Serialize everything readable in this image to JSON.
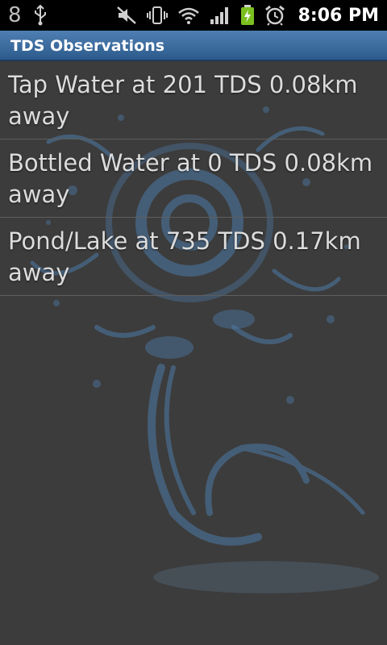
{
  "status_bar": {
    "notification_count": "8",
    "time": "8:06 PM",
    "icons": [
      "usb-icon",
      "mute-icon",
      "vibrate-icon",
      "wifi-icon",
      "signal-icon",
      "battery-charging-icon",
      "alarm-clock-icon"
    ]
  },
  "title_bar": {
    "title": "TDS Observations"
  },
  "observations": [
    {
      "label": "Tap Water at 201 TDS 0.08km away"
    },
    {
      "label": "Bottled Water at 0 TDS 0.08km away"
    },
    {
      "label": "Pond/Lake at 735 TDS 0.17km away"
    }
  ],
  "colors": {
    "title_bar": "#3b6ea5",
    "background": "#3c3c3c",
    "text": "#dcdcdc",
    "art": "#3f6f9f"
  }
}
